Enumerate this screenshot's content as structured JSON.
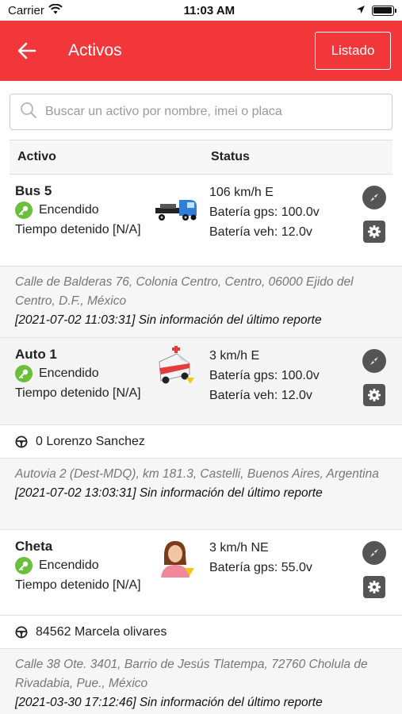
{
  "status_bar": {
    "carrier": "Carrier",
    "time": "11:03 AM"
  },
  "header": {
    "title": "Activos",
    "list_button": "Listado"
  },
  "search": {
    "placeholder": "Buscar un activo por nombre, imei o placa"
  },
  "table": {
    "col_asset": "Activo",
    "col_status": "Status"
  },
  "colors": {
    "header_bg": "#f2373a",
    "key_green": "#6cbf3a",
    "action_gray": "#555555"
  },
  "assets": [
    {
      "name": "Bus 5",
      "state": "Encendido",
      "stopped": "Tiempo detenido [N/A]",
      "icon": "tow-truck-icon",
      "speed": "106 km/h E",
      "battery_gps": "Batería gps: 100.0v",
      "battery_veh": "Batería veh: 12.0v",
      "driver": "",
      "address": "Calle de Balderas 76, Colonia Centro, Centro, 06000 Ejido del Centro, D.F., México",
      "report": "[2021-07-02 11:03:31] Sin información del último reporte"
    },
    {
      "name": "Auto 1",
      "state": "Encendido",
      "stopped": "Tiempo detenido [N/A]",
      "icon": "ambulance-icon",
      "speed": "3 km/h E",
      "battery_gps": "Batería gps: 100.0v",
      "battery_veh": "Batería veh: 12.0v",
      "driver": "0 Lorenzo Sanchez",
      "address": "Autovia 2 (Dest-MDQ), km 181.3, Castelli, Buenos Aires, Argentina",
      "report": "[2021-07-02 13:03:31] Sin información del último reporte"
    },
    {
      "name": "Cheta",
      "state": "Encendido",
      "stopped": "Tiempo detenido [N/A]",
      "icon": "person-icon",
      "speed": "3 km/h NE",
      "battery_gps": "Batería gps: 55.0v",
      "battery_veh": "",
      "driver": "84562 Marcela olivares",
      "address": "Calle 38 Ote. 3401, Barrio de Jesús Tlatempa, 72760 Cholula de Rivadabia, Pue., México",
      "report": "[2021-03-30 17:12:46] Sin información del último reporte"
    }
  ]
}
